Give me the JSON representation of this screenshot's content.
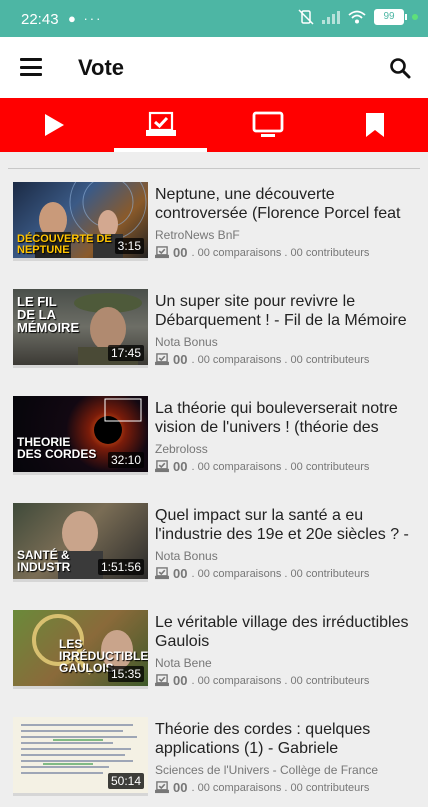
{
  "status": {
    "time": "22:43",
    "left_icons": "●  ···",
    "battery": "99"
  },
  "header": {
    "title": "Vote"
  },
  "tabs": [
    {
      "name": "play-icon",
      "active": false
    },
    {
      "name": "vote-icon",
      "active": true
    },
    {
      "name": "monitor-icon",
      "active": false
    },
    {
      "name": "bookmark-icon",
      "active": false
    }
  ],
  "videos": [
    {
      "title": "Neptune, une découverte controversée (Florence Porcel feat ...",
      "channel": "RetroNews BnF",
      "count": "00",
      "comparisons": "00 comparaisons",
      "contributors": "00 contributeurs",
      "duration": "3:15",
      "thumb_text": "DÉCOUVERTE DE NEPTUNE"
    },
    {
      "title": "Un super site pour revivre le Débarquement ! - Fil de la Mémoire",
      "channel": "Nota Bonus",
      "count": "00",
      "comparisons": "00 comparaisons",
      "contributors": "00 contributeurs",
      "duration": "17:45",
      "thumb_text": "LE FIL DE LA MÉMOIRE"
    },
    {
      "title": "La théorie qui bouleverserait notre vision de l'univers ! (théorie des cord...",
      "channel": "Zebroloss",
      "count": "00",
      "comparisons": "00 comparaisons",
      "contributors": "00 contributeurs",
      "duration": "32:10",
      "thumb_text": "THEORIE DES CORDES"
    },
    {
      "title": "Quel impact sur la santé a eu l'industrie des 19e et 20e siècles ? - ...",
      "channel": "Nota Bonus",
      "count": "00",
      "comparisons": "00 comparaisons",
      "contributors": "00 contributeurs",
      "duration": "1:51:56",
      "thumb_text": "SANTÉ & INDUSTR"
    },
    {
      "title": "Le véritable village des irréductibles Gaulois",
      "channel": "Nota Bene",
      "count": "00",
      "comparisons": "00 comparaisons",
      "contributors": "00 contributeurs",
      "duration": "15:35",
      "thumb_text": "LES IRRÉDUCTIBLES GAULOIS"
    },
    {
      "title": "Théorie des cordes : quelques applications (1) - Gabriele Veneziano...",
      "channel": "Sciences de l'Univers - Collège de France",
      "count": "00",
      "comparisons": "00 comparaisons",
      "contributors": "00 contributeurs",
      "duration": "50:14",
      "thumb_text": ""
    }
  ],
  "colors": {
    "status_bar": "#4db6a4",
    "tab_bar": "#ff0000",
    "background": "#eeeeee"
  }
}
